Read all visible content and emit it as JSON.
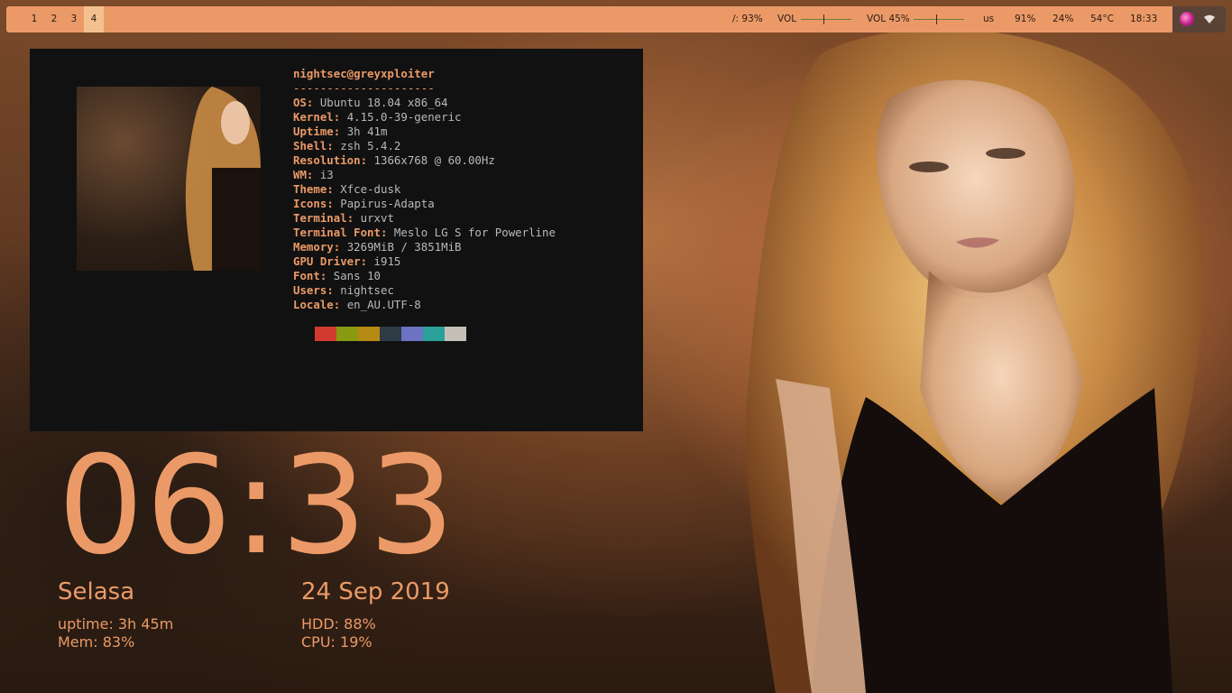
{
  "workspaces": [
    {
      "label": "1",
      "active": false
    },
    {
      "label": "2",
      "active": false
    },
    {
      "label": "3",
      "active": false
    },
    {
      "label": "4",
      "active": true
    }
  ],
  "status": {
    "disk": "/: 93%",
    "vol1_label": "VOL",
    "vol1_level": 0.45,
    "vol2_label": "VOL 45%",
    "vol2_level": 0.45,
    "keyboard": "us",
    "brightness": "91%",
    "cpu": "24%",
    "temp": "54°C",
    "time": "18:33"
  },
  "tray": {
    "icon_a": "app-tray-icon",
    "icon_b": "wifi-icon"
  },
  "neofetch": {
    "title": "nightsec@greyxploiter",
    "separator": "---------------------",
    "rows": [
      {
        "key": "OS",
        "value": "Ubuntu 18.04 x86_64"
      },
      {
        "key": "Kernel",
        "value": "4.15.0-39-generic"
      },
      {
        "key": "Uptime",
        "value": "3h 41m"
      },
      {
        "key": "Shell",
        "value": "zsh 5.4.2"
      },
      {
        "key": "Resolution",
        "value": "1366x768 @ 60.00Hz"
      },
      {
        "key": "WM",
        "value": "i3"
      },
      {
        "key": "Theme",
        "value": "Xfce-dusk"
      },
      {
        "key": "Icons",
        "value": "Papirus-Adapta"
      },
      {
        "key": "Terminal",
        "value": "urxvt"
      },
      {
        "key": "Terminal Font",
        "value": "Meslo LG S for Powerline"
      },
      {
        "key": "Memory",
        "value": "3269MiB / 3851MiB"
      },
      {
        "key": "GPU Driver",
        "value": "i915"
      },
      {
        "key": "Font",
        "value": "Sans 10"
      },
      {
        "key": "Users",
        "value": "nightsec"
      },
      {
        "key": "Locale",
        "value": "en_AU.UTF-8"
      }
    ],
    "palette": [
      "#d23a2f",
      "#889a10",
      "#b58a13",
      "#2e3b44",
      "#6c72c4",
      "#2aa198",
      "#c4c0b7"
    ]
  },
  "clock": {
    "time": "06:33",
    "day": "Selasa",
    "date": "24 Sep 2019",
    "uptime": "uptime: 3h 45m",
    "mem": "Mem: 83%",
    "hdd": "HDD: 88%",
    "cpu": "CPU: 19%"
  },
  "colors": {
    "accent": "#eb9a67",
    "panel": "#111111",
    "bar": "#eb9a67"
  }
}
